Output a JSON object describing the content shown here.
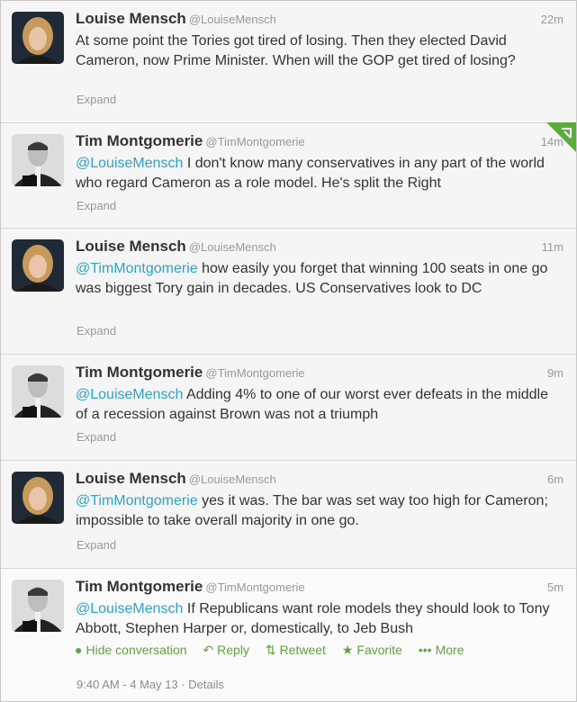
{
  "tweets": [
    {
      "name": "Louise Mensch",
      "handle": "@LouiseMensch",
      "time": "22m",
      "mention": "",
      "text": "At some point the Tories got tired of losing. Then they elected David Cameron, now Prime Minister. When will the GOP get tired of losing?",
      "expand": "Expand"
    },
    {
      "name": "Tim Montgomerie",
      "handle": "@TimMontgomerie",
      "time": "14m",
      "mention": "@LouiseMensch",
      "text": " I don't know many conservatives in any part of the world who regard Cameron as a role model. He's split the Right",
      "expand": "Expand"
    },
    {
      "name": "Louise Mensch",
      "handle": "@LouiseMensch",
      "time": "11m",
      "mention": "@TimMontgomerie",
      "text": " how easily you forget that winning 100 seats in one go was biggest Tory gain in decades. US Conservatives look to DC",
      "expand": "Expand"
    },
    {
      "name": "Tim Montgomerie",
      "handle": "@TimMontgomerie",
      "time": "9m",
      "mention": "@LouiseMensch",
      "text": " Adding 4% to one of our worst ever defeats in the middle of a recession against Brown was not a triumph",
      "expand": "Expand"
    },
    {
      "name": "Louise Mensch",
      "handle": "@LouiseMensch",
      "time": "6m",
      "mention": "@TimMontgomerie",
      "text": " yes it was. The bar was set way too high for Cameron; impossible to take overall majority in one go.",
      "expand": "Expand"
    },
    {
      "name": "Tim Montgomerie",
      "handle": "@TimMontgomerie",
      "time": "5m",
      "mention": "@LouiseMensch",
      "text": " If Republicans want role models they should look to Tony Abbott, Stephen Harper or, domestically, to Jeb Bush"
    }
  ],
  "actions": {
    "hide_conversation": "Hide conversation",
    "reply": "Reply",
    "retweet": "Retweet",
    "favorite": "Favorite",
    "more": "More"
  },
  "footer": {
    "timestamp": "9:40 AM - 4 May 13",
    "separator": " · ",
    "details": "Details"
  },
  "icons": {
    "hide_conversation": "speech-bubble-icon",
    "reply": "reply-arrow-icon",
    "retweet": "retweet-icon",
    "favorite": "star-icon",
    "more": "ellipsis-icon",
    "corner": "retweeted-corner-icon"
  },
  "colors": {
    "mention": "#2fa3c8",
    "action": "#62a243",
    "corner": "#5aaa3c",
    "muted": "#999999",
    "text": "#333333"
  }
}
